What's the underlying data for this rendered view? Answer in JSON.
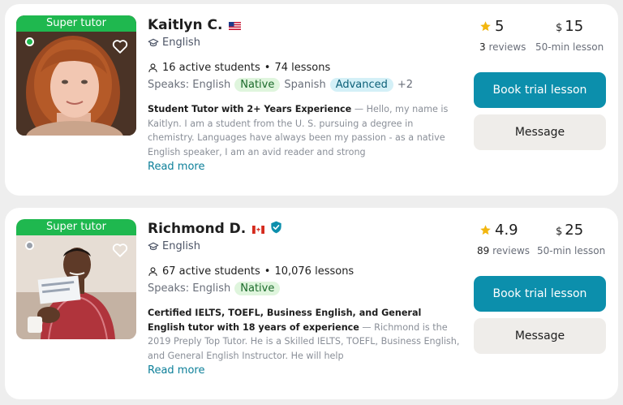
{
  "tutors": [
    {
      "badge": "Super tutor",
      "name": "Kaitlyn C.",
      "flag_icon": "us-flag-icon",
      "verified": false,
      "online": true,
      "subject": "English",
      "active_students": "16 active students",
      "stats_sep": "•",
      "lessons": "74 lessons",
      "speaks_label": "Speaks:",
      "languages": [
        {
          "name": "English",
          "level": "Native"
        },
        {
          "name": "Spanish",
          "level": "Advanced"
        }
      ],
      "more_languages": "+2",
      "headline": "Student Tutor with 2+ Years Experience",
      "description": " — Hello, my name is Kaitlyn. I am a student from the U. S. pursuing a degree in chemistry. Languages have always been my passion - as a native English speaker, I am an avid reader and strong",
      "read_more": "Read more",
      "rating": "5",
      "reviews_count": "3",
      "reviews_label": "reviews",
      "currency": "$",
      "price": "15",
      "lesson_label": "50-min lesson",
      "book_label": "Book trial lesson",
      "message_label": "Message"
    },
    {
      "badge": "Super tutor",
      "name": "Richmond D.",
      "flag_icon": "canada-flag-icon",
      "verified": true,
      "online": false,
      "subject": "English",
      "active_students": "67 active students",
      "stats_sep": "•",
      "lessons": "10,076 lessons",
      "speaks_label": "Speaks:",
      "languages": [
        {
          "name": "English",
          "level": "Native"
        }
      ],
      "headline": "Certified IELTS, TOEFL, Business English, and General English tutor with 18 years of experience",
      "description": " — Richmond is the 2019 Preply Top Tutor. He is a Skilled IELTS, TOEFL, Business English, and General English Instructor. He will help",
      "read_more": "Read more",
      "rating": "4.9",
      "reviews_count": "89",
      "reviews_label": "reviews",
      "currency": "$",
      "price": "25",
      "lesson_label": "50-min lesson",
      "book_label": "Book trial lesson",
      "message_label": "Message"
    }
  ],
  "colors": {
    "super_badge": "#1fb84f",
    "book_button": "#0c8fac",
    "message_button": "#efedea",
    "star": "#f2b60f",
    "online_dot": "#1fb84f",
    "offline_dot": "#9aa0aa",
    "link": "#0c7f99"
  }
}
